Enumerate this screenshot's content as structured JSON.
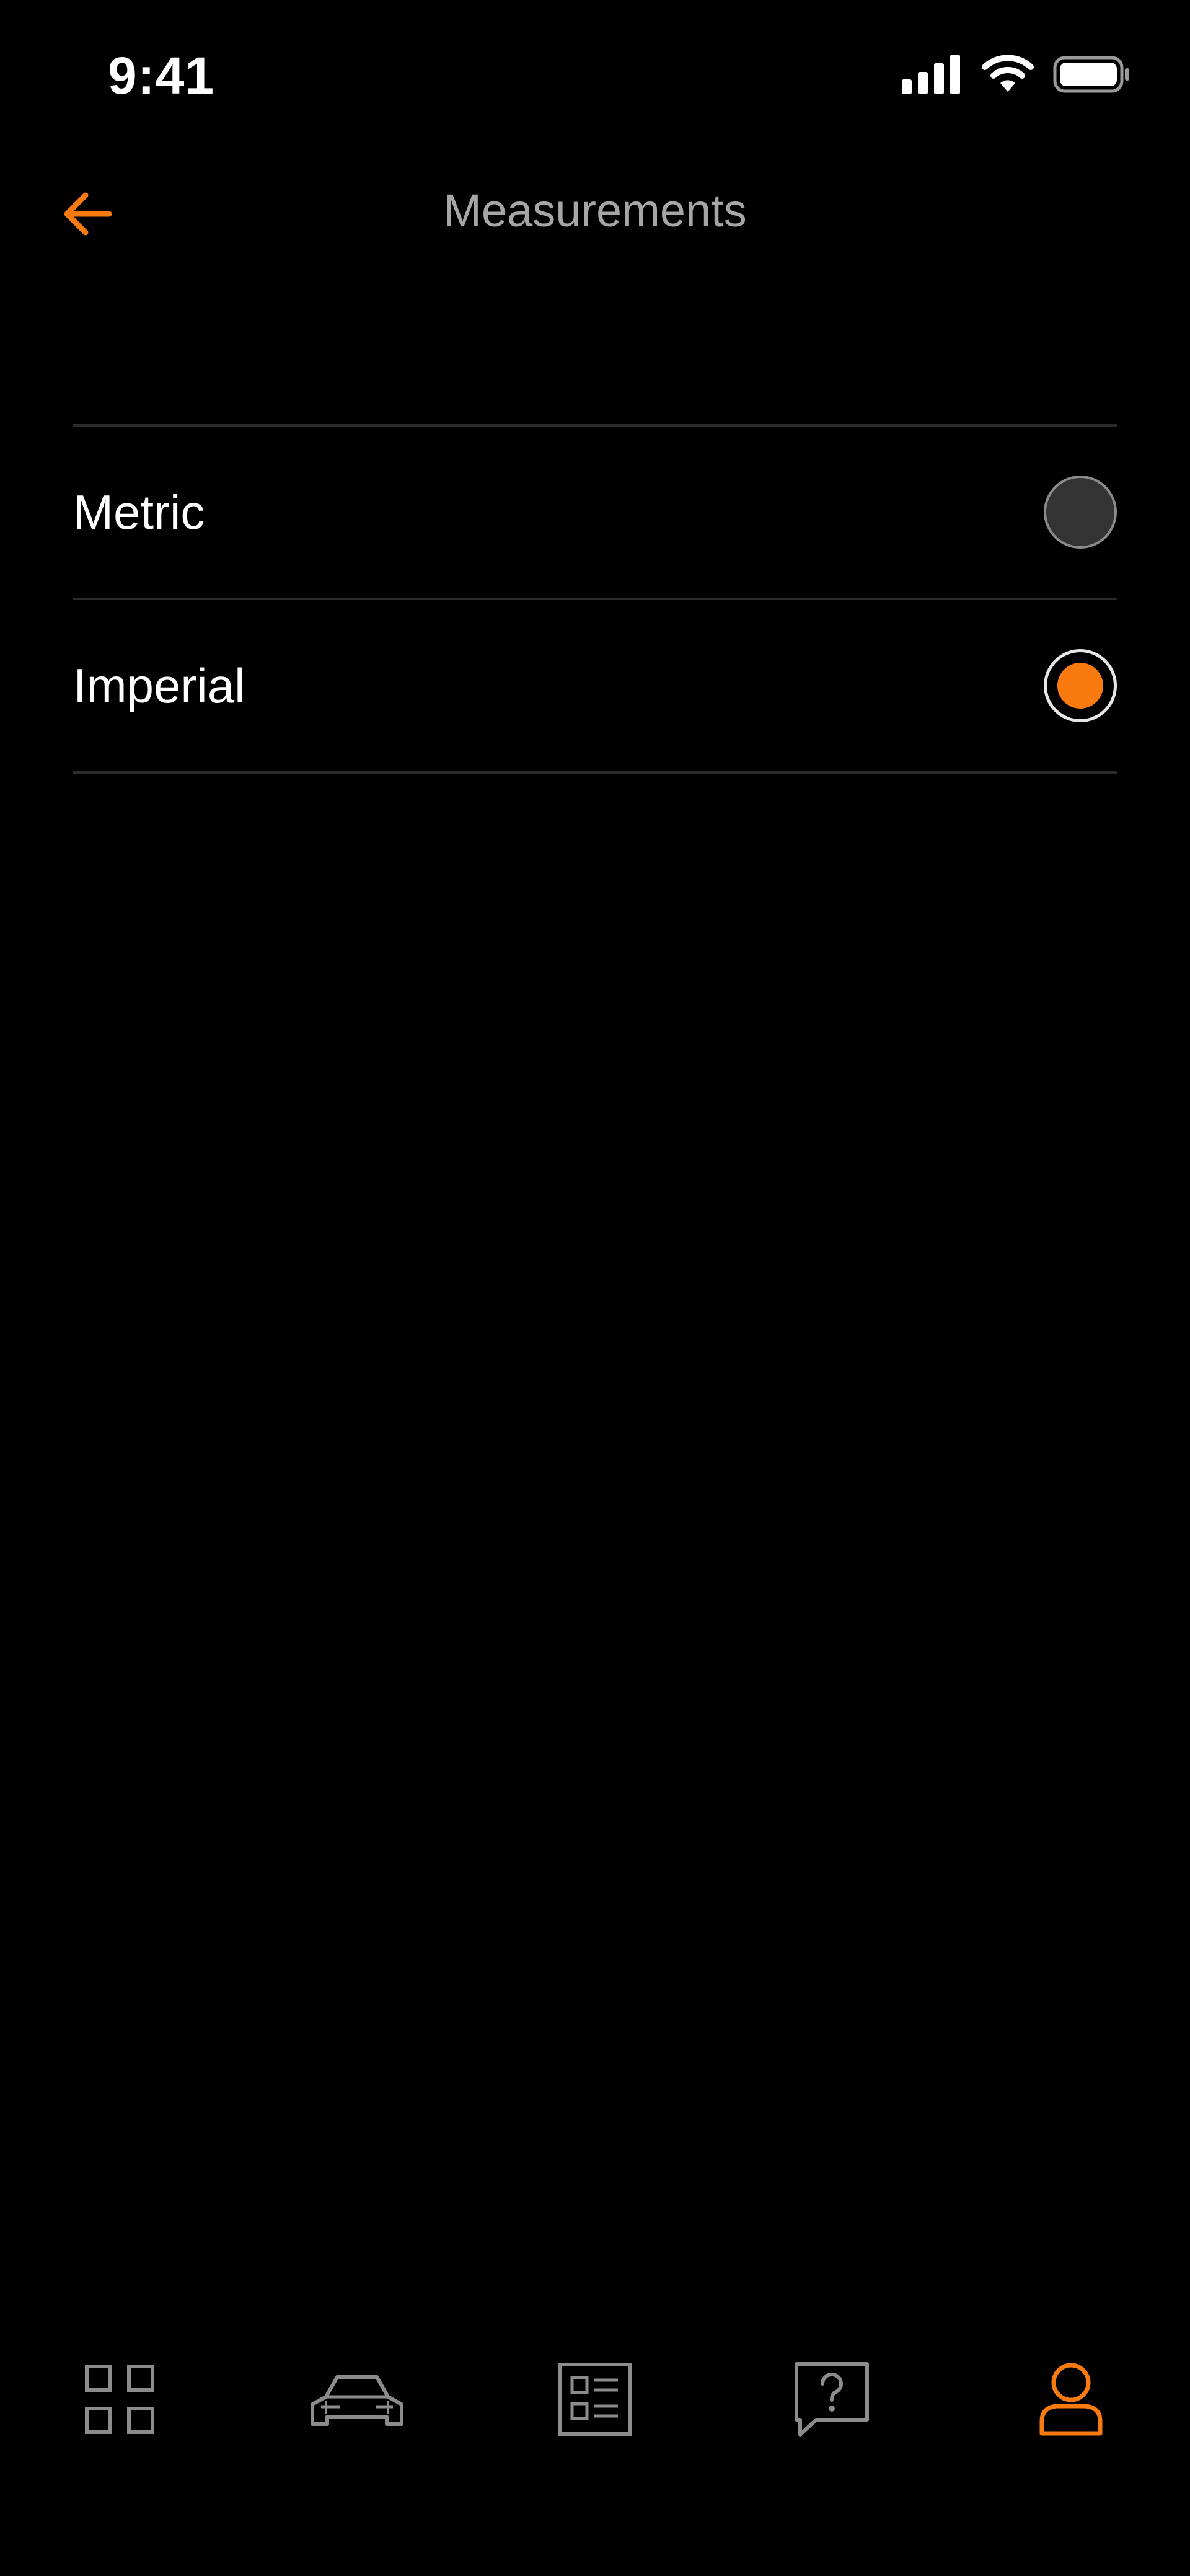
{
  "status_bar": {
    "time": "9:41"
  },
  "header": {
    "title": "Measurements",
    "back_icon": "arrow-left-icon"
  },
  "options": [
    {
      "label": "Metric",
      "selected": false
    },
    {
      "label": "Imperial",
      "selected": true
    }
  ],
  "tabbar": {
    "items": [
      {
        "icon": "dashboard-grid-icon",
        "active": false
      },
      {
        "icon": "car-icon",
        "active": false
      },
      {
        "icon": "list-document-icon",
        "active": false
      },
      {
        "icon": "help-chat-icon",
        "active": false
      },
      {
        "icon": "profile-icon",
        "active": true
      }
    ]
  },
  "colors": {
    "background": "#000000",
    "accent": "#f97b0f",
    "title_text": "#a6a6a6",
    "divider": "#2b2b2b",
    "inactive_icon": "#8c8c8c"
  }
}
